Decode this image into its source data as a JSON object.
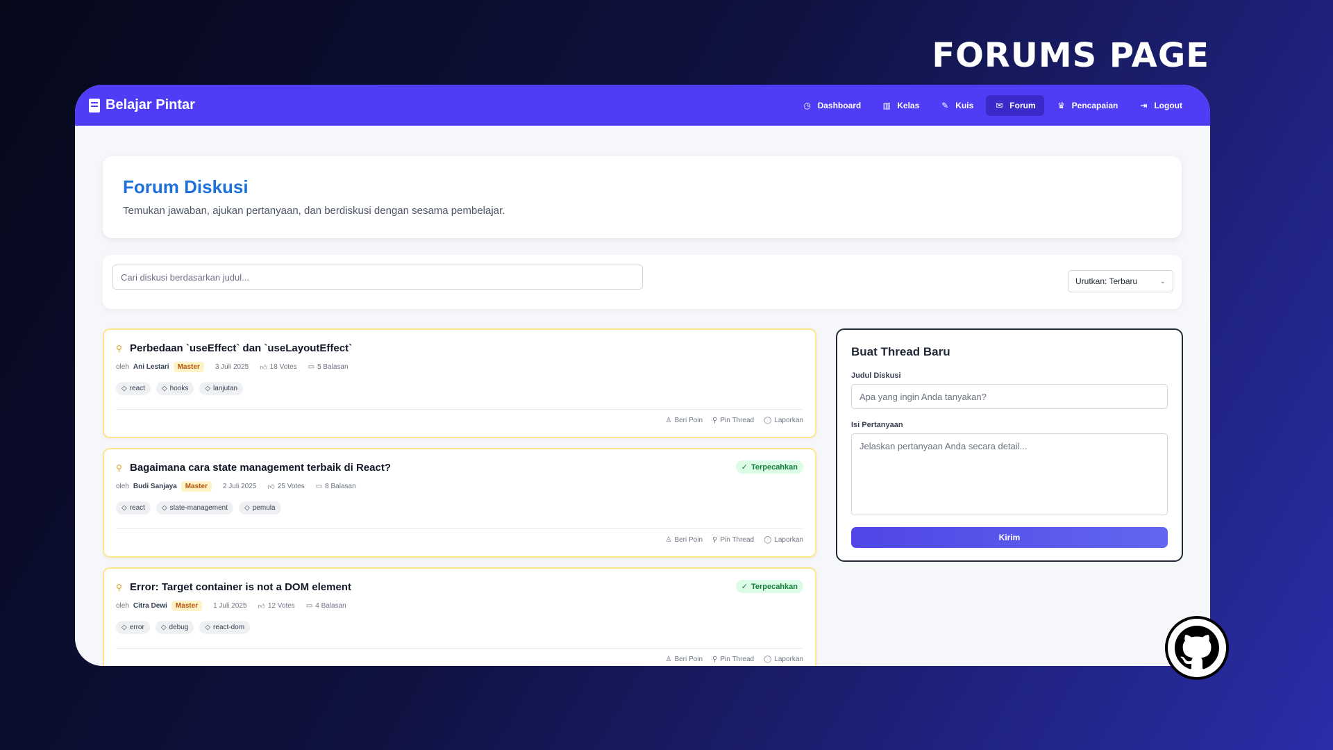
{
  "banner": {
    "title": "FORUMS PAGE"
  },
  "navbar": {
    "brand": "Belajar Pintar",
    "items": [
      {
        "label": "Dashboard",
        "icon": "gauge-icon",
        "glyph": "◷",
        "active": false
      },
      {
        "label": "Kelas",
        "icon": "book-open-icon",
        "glyph": "▥",
        "active": false
      },
      {
        "label": "Kuis",
        "icon": "pencil-icon",
        "glyph": "✎",
        "active": false
      },
      {
        "label": "Forum",
        "icon": "comments-icon",
        "glyph": "✉",
        "active": true
      },
      {
        "label": "Pencapaian",
        "icon": "trophy-icon",
        "glyph": "♛",
        "active": false
      },
      {
        "label": "Logout",
        "icon": "logout-icon",
        "glyph": "⇥",
        "active": false
      }
    ]
  },
  "header": {
    "title": "Forum Diskusi",
    "subtitle": "Temukan jawaban, ajukan pertanyaan, dan berdiskusi dengan sesama pembelajar."
  },
  "filters": {
    "search_placeholder": "Cari diskusi berdasarkan judul...",
    "sort_label": "Urutkan: Terbaru"
  },
  "threads": [
    {
      "title": "Perbedaan `useEffect` dan `useLayoutEffect`",
      "by": "oleh",
      "author": "Ani Lestari",
      "rank": "Master",
      "date": "3 Juli 2025",
      "votes": "18 Votes",
      "replies": "5 Balasan",
      "solved": "",
      "tags": [
        "react",
        "hooks",
        "lanjutan"
      ]
    },
    {
      "title": "Bagaimana cara state management terbaik di React?",
      "by": "oleh",
      "author": "Budi Sanjaya",
      "rank": "Master",
      "date": "2 Juli 2025",
      "votes": "25 Votes",
      "replies": "8 Balasan",
      "solved": "Terpecahkan",
      "tags": [
        "react",
        "state-management",
        "pemula"
      ]
    },
    {
      "title": "Error: Target container is not a DOM element",
      "by": "oleh",
      "author": "Citra Dewi",
      "rank": "Master",
      "date": "1 Juli 2025",
      "votes": "12 Votes",
      "replies": "4 Balasan",
      "solved": "Terpecahkan",
      "tags": [
        "error",
        "debug",
        "react-dom"
      ]
    }
  ],
  "thread_actions": {
    "give_points": "Beri Poin",
    "pin": "Pin Thread",
    "report": "Laporkan"
  },
  "new_thread": {
    "title": "Buat Thread Baru",
    "title_label": "Judul Diskusi",
    "title_placeholder": "Apa yang ingin Anda tanyakan?",
    "body_label": "Isi Pertanyaan",
    "body_placeholder": "Jelaskan pertanyaan Anda secara detail...",
    "submit": "Kirim"
  },
  "colors": {
    "primary": "#4f3df5",
    "title_blue": "#1e6fd9",
    "solved_green": "#15803d",
    "pin_gold": "#d4a017"
  }
}
